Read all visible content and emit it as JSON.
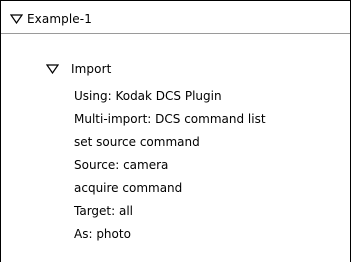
{
  "tree": {
    "root": {
      "label": "Example-1",
      "expanded": true,
      "icon": "disclosure-triangle-down-icon"
    },
    "child": {
      "label": "Import",
      "expanded": true,
      "icon": "disclosure-triangle-down-icon",
      "steps": [
        "Using: Kodak DCS Plugin",
        "Multi-import: DCS command list",
        "set source command",
        "Source: camera",
        "acquire command",
        "Target: all",
        "As: photo"
      ]
    }
  }
}
